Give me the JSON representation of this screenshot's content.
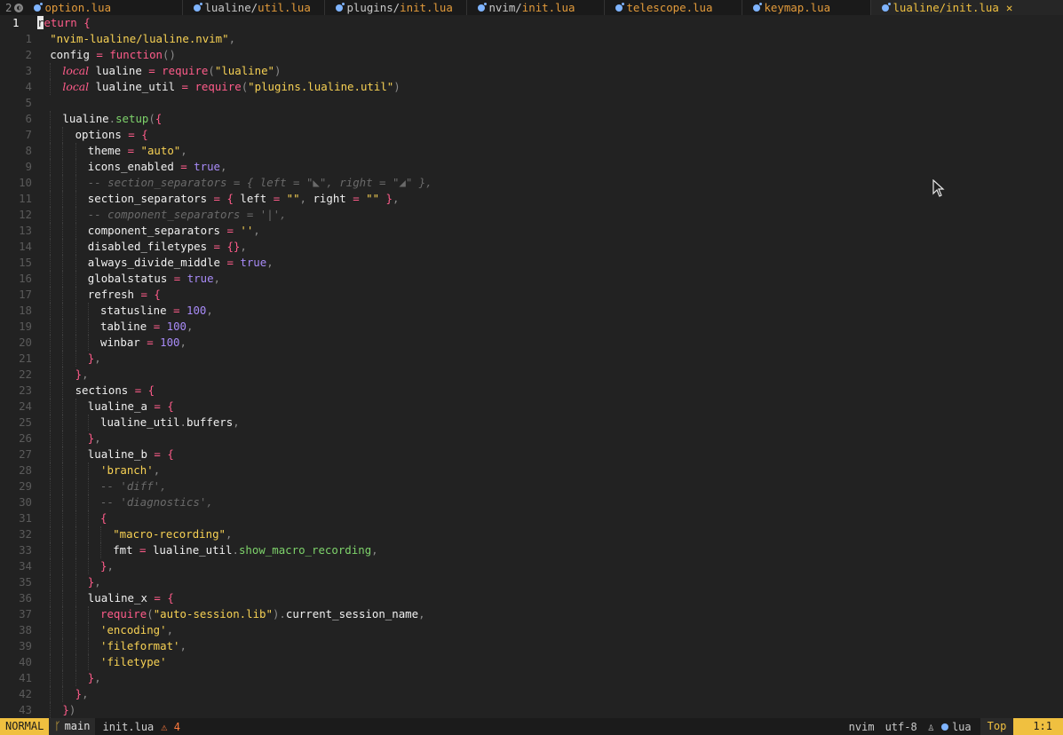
{
  "tabline": {
    "tab_count": "2",
    "tabs": [
      {
        "dir": "",
        "file": "option.lua",
        "active": false
      },
      {
        "dir": "lualine/",
        "file": "util.lua",
        "active": false
      },
      {
        "dir": "plugins/",
        "file": "init.lua",
        "active": false
      },
      {
        "dir": "nvim/",
        "file": "init.lua",
        "active": false
      },
      {
        "dir": "",
        "file": "telescope.lua",
        "active": false
      },
      {
        "dir": "",
        "file": "keymap.lua",
        "active": false
      },
      {
        "dir": "lualine/",
        "file": "init.lua",
        "active": true,
        "close": "✕"
      }
    ]
  },
  "editor": {
    "current_line": 1,
    "lines": [
      {
        "n": "1",
        "indent": 0,
        "t": [
          [
            "cursor",
            "r"
          ],
          [
            "kw",
            "eturn "
          ],
          [
            "brace",
            "{"
          ]
        ]
      },
      {
        "n": "1",
        "indent": 1,
        "t": [
          [
            "str",
            "\"nvim-lualine/lualine.nvim\""
          ],
          [
            "punc",
            ","
          ]
        ]
      },
      {
        "n": "2",
        "indent": 1,
        "t": [
          [
            "var",
            "config "
          ],
          [
            "op",
            "= "
          ],
          [
            "kw",
            "function"
          ],
          [
            "punc",
            "()"
          ]
        ]
      },
      {
        "n": "3",
        "indent": 2,
        "t": [
          [
            "kw-it",
            "local"
          ],
          [
            "var",
            " lualine "
          ],
          [
            "op",
            "= "
          ],
          [
            "kw",
            "require"
          ],
          [
            "punc",
            "("
          ],
          [
            "str",
            "\"lualine\""
          ],
          [
            "punc",
            ")"
          ]
        ]
      },
      {
        "n": "4",
        "indent": 2,
        "t": [
          [
            "kw-it",
            "local"
          ],
          [
            "var",
            " lualine_util "
          ],
          [
            "op",
            "= "
          ],
          [
            "kw",
            "require"
          ],
          [
            "punc",
            "("
          ],
          [
            "str",
            "\"plugins.lualine.util\""
          ],
          [
            "punc",
            ")"
          ]
        ]
      },
      {
        "n": "5",
        "indent": 0,
        "t": []
      },
      {
        "n": "6",
        "indent": 2,
        "t": [
          [
            "var",
            "lualine"
          ],
          [
            "punc",
            "."
          ],
          [
            "fn",
            "setup"
          ],
          [
            "punc",
            "("
          ],
          [
            "brace",
            "{"
          ]
        ]
      },
      {
        "n": "7",
        "indent": 3,
        "t": [
          [
            "var",
            "options "
          ],
          [
            "op",
            "= "
          ],
          [
            "brace",
            "{"
          ]
        ]
      },
      {
        "n": "8",
        "indent": 4,
        "t": [
          [
            "var",
            "theme "
          ],
          [
            "op",
            "= "
          ],
          [
            "str",
            "\"auto\""
          ],
          [
            "punc",
            ","
          ]
        ]
      },
      {
        "n": "9",
        "indent": 4,
        "t": [
          [
            "var",
            "icons_enabled "
          ],
          [
            "op",
            "= "
          ],
          [
            "bool",
            "true"
          ],
          [
            "punc",
            ","
          ]
        ]
      },
      {
        "n": "10",
        "indent": 4,
        "t": [
          [
            "cmt",
            "-- section_separators = { left = \"◣\", right = \"◢\" },"
          ]
        ]
      },
      {
        "n": "11",
        "indent": 4,
        "t": [
          [
            "var",
            "section_separators "
          ],
          [
            "op",
            "= "
          ],
          [
            "brace",
            "{ "
          ],
          [
            "var",
            "left "
          ],
          [
            "op",
            "= "
          ],
          [
            "str",
            "\"\""
          ],
          [
            "punc",
            ", "
          ],
          [
            "var",
            "right "
          ],
          [
            "op",
            "= "
          ],
          [
            "str",
            "\"\" "
          ],
          [
            "brace",
            "}"
          ],
          [
            "punc",
            ","
          ]
        ]
      },
      {
        "n": "12",
        "indent": 4,
        "t": [
          [
            "cmt",
            "-- component_separators = '|',"
          ]
        ]
      },
      {
        "n": "13",
        "indent": 4,
        "t": [
          [
            "var",
            "component_separators "
          ],
          [
            "op",
            "= "
          ],
          [
            "str",
            "''"
          ],
          [
            "punc",
            ","
          ]
        ]
      },
      {
        "n": "14",
        "indent": 4,
        "t": [
          [
            "var",
            "disabled_filetypes "
          ],
          [
            "op",
            "= "
          ],
          [
            "brace",
            "{}"
          ],
          [
            "punc",
            ","
          ]
        ]
      },
      {
        "n": "15",
        "indent": 4,
        "t": [
          [
            "var",
            "always_divide_middle "
          ],
          [
            "op",
            "= "
          ],
          [
            "bool",
            "true"
          ],
          [
            "punc",
            ","
          ]
        ]
      },
      {
        "n": "16",
        "indent": 4,
        "t": [
          [
            "var",
            "globalstatus "
          ],
          [
            "op",
            "= "
          ],
          [
            "bool",
            "true"
          ],
          [
            "punc",
            ","
          ]
        ]
      },
      {
        "n": "17",
        "indent": 4,
        "t": [
          [
            "var",
            "refresh "
          ],
          [
            "op",
            "= "
          ],
          [
            "brace",
            "{"
          ]
        ]
      },
      {
        "n": "18",
        "indent": 5,
        "t": [
          [
            "var",
            "statusline "
          ],
          [
            "op",
            "= "
          ],
          [
            "num",
            "100"
          ],
          [
            "punc",
            ","
          ]
        ]
      },
      {
        "n": "19",
        "indent": 5,
        "t": [
          [
            "var",
            "tabline "
          ],
          [
            "op",
            "= "
          ],
          [
            "num",
            "100"
          ],
          [
            "punc",
            ","
          ]
        ]
      },
      {
        "n": "20",
        "indent": 5,
        "t": [
          [
            "var",
            "winbar "
          ],
          [
            "op",
            "= "
          ],
          [
            "num",
            "100"
          ],
          [
            "punc",
            ","
          ]
        ]
      },
      {
        "n": "21",
        "indent": 4,
        "t": [
          [
            "brace",
            "}"
          ],
          [
            "punc",
            ","
          ]
        ]
      },
      {
        "n": "22",
        "indent": 3,
        "t": [
          [
            "brace",
            "}"
          ],
          [
            "punc",
            ","
          ]
        ]
      },
      {
        "n": "23",
        "indent": 3,
        "t": [
          [
            "var",
            "sections "
          ],
          [
            "op",
            "= "
          ],
          [
            "brace",
            "{"
          ]
        ]
      },
      {
        "n": "24",
        "indent": 4,
        "t": [
          [
            "var",
            "lualine_a "
          ],
          [
            "op",
            "= "
          ],
          [
            "brace",
            "{"
          ]
        ]
      },
      {
        "n": "25",
        "indent": 5,
        "t": [
          [
            "var",
            "lualine_util"
          ],
          [
            "punc",
            "."
          ],
          [
            "var",
            "buffers"
          ],
          [
            "punc",
            ","
          ]
        ]
      },
      {
        "n": "26",
        "indent": 4,
        "t": [
          [
            "brace",
            "}"
          ],
          [
            "punc",
            ","
          ]
        ]
      },
      {
        "n": "27",
        "indent": 4,
        "t": [
          [
            "var",
            "lualine_b "
          ],
          [
            "op",
            "= "
          ],
          [
            "brace",
            "{"
          ]
        ]
      },
      {
        "n": "28",
        "indent": 5,
        "t": [
          [
            "str",
            "'branch'"
          ],
          [
            "punc",
            ","
          ]
        ]
      },
      {
        "n": "29",
        "indent": 5,
        "t": [
          [
            "cmt",
            "-- 'diff',"
          ]
        ]
      },
      {
        "n": "30",
        "indent": 5,
        "t": [
          [
            "cmt",
            "-- 'diagnostics',"
          ]
        ]
      },
      {
        "n": "31",
        "indent": 5,
        "t": [
          [
            "brace",
            "{"
          ]
        ]
      },
      {
        "n": "32",
        "indent": 6,
        "t": [
          [
            "str",
            "\"macro-recording\""
          ],
          [
            "punc",
            ","
          ]
        ]
      },
      {
        "n": "33",
        "indent": 6,
        "t": [
          [
            "var",
            "fmt "
          ],
          [
            "op",
            "= "
          ],
          [
            "var",
            "lualine_util"
          ],
          [
            "punc",
            "."
          ],
          [
            "fn",
            "show_macro_recording"
          ],
          [
            "punc",
            ","
          ]
        ]
      },
      {
        "n": "34",
        "indent": 5,
        "t": [
          [
            "brace",
            "}"
          ],
          [
            "punc",
            ","
          ]
        ]
      },
      {
        "n": "35",
        "indent": 4,
        "t": [
          [
            "brace",
            "}"
          ],
          [
            "punc",
            ","
          ]
        ]
      },
      {
        "n": "36",
        "indent": 4,
        "t": [
          [
            "var",
            "lualine_x "
          ],
          [
            "op",
            "= "
          ],
          [
            "brace",
            "{"
          ]
        ]
      },
      {
        "n": "37",
        "indent": 5,
        "t": [
          [
            "kw",
            "require"
          ],
          [
            "punc",
            "("
          ],
          [
            "str",
            "\"auto-session.lib\""
          ],
          [
            "punc",
            ")."
          ],
          [
            "var",
            "current_session_name"
          ],
          [
            "punc",
            ","
          ]
        ]
      },
      {
        "n": "38",
        "indent": 5,
        "t": [
          [
            "str",
            "'encoding'"
          ],
          [
            "punc",
            ","
          ]
        ]
      },
      {
        "n": "39",
        "indent": 5,
        "t": [
          [
            "str",
            "'fileformat'"
          ],
          [
            "punc",
            ","
          ]
        ]
      },
      {
        "n": "40",
        "indent": 5,
        "t": [
          [
            "str",
            "'filetype'"
          ]
        ]
      },
      {
        "n": "41",
        "indent": 4,
        "t": [
          [
            "brace",
            "}"
          ],
          [
            "punc",
            ","
          ]
        ]
      },
      {
        "n": "42",
        "indent": 3,
        "t": [
          [
            "brace",
            "}"
          ],
          [
            "punc",
            ","
          ]
        ]
      },
      {
        "n": "43",
        "indent": 2,
        "t": [
          [
            "brace",
            "}"
          ],
          [
            "punc",
            ")"
          ]
        ]
      }
    ]
  },
  "statusline": {
    "mode": "NORMAL",
    "branch_icon": "ᚴ",
    "branch": "main",
    "filename": "init.lua",
    "diagnostics": "⚠ 4",
    "session": "nvim",
    "encoding": "utf-8",
    "os_icon": "♙",
    "filetype": "lua",
    "position_label": "Top",
    "location": "1:1"
  }
}
